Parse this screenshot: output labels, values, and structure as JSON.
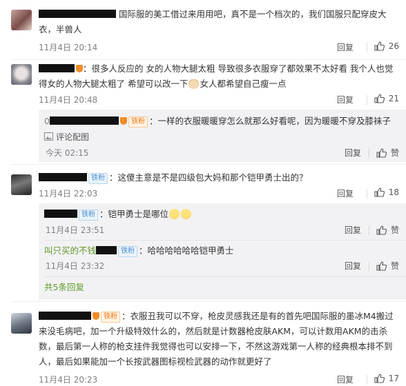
{
  "comments": [
    {
      "text": "国际服的美工借过来用用吧，真不是一个档次的，我们国服只配穿皮大衣，半兽人",
      "time": "11月4日 20:14",
      "reply": "回复",
      "likes": "26"
    },
    {
      "text_a": "：很多人反应的 女的人物大腿太粗 导致很多衣服穿了都效果不太好看 我个人也觉得女的人物大腿太粗了 希望可以改一下",
      "text_b": "女人都希望自己瘦一点",
      "time": "11月4日 20:48",
      "reply": "回复",
      "likes": "21",
      "replies": [
        {
          "badge": "铁粉",
          "text": "一样的衣服暖暖穿怎么就那么好看呢，因为暖暖不穿及膝袜子",
          "extra": "评论配图",
          "time": "今天 02:15",
          "reply": "回复",
          "like_label": "赞"
        }
      ]
    },
    {
      "badge": "铁粉",
      "text": "这傻主意是不是四级包大妈和那个铠甲勇士出的？",
      "time": "11月4日 22:03",
      "reply": "回复",
      "likes": "18",
      "replies": [
        {
          "badge": "铁粉",
          "text": "铠甲勇士是哪位",
          "time": "11月4日 23:51",
          "reply": "回复",
          "like_label": "赞"
        },
        {
          "name_visible": "叫只买的不钱",
          "badge": "铁粉",
          "text": "哈哈哈哈哈哈铠甲勇士",
          "time": "11月4日 23:32",
          "reply": "回复",
          "like_label": "赞"
        }
      ],
      "more_replies": "共5条回复"
    },
    {
      "badge": "铁粉",
      "text": "：衣服丑我可以不穿，枪皮灵感我还是有的首先吧国际服的墨冰M4搬过来没毛病吧，加一个升级特效什么的，然后就是计数器枪皮肤AKM，可以计数用AKM的击杀数，最后第一人称的枪支挂件我觉得也可以安排一下，不然这游戏第一人称的经典根本排不到人，最后如果能加一个长按武器图标视检武器的动作就更好了",
      "time": "11月4日 20:23",
      "reply": "回复",
      "likes": "17"
    }
  ],
  "icons": {
    "like": "thumb-up-icon",
    "badge_icon": "shield-icon",
    "image": "image-icon"
  },
  "colors": {
    "text": "#333333",
    "meta": "#808080",
    "green": "#629925",
    "badge_blue": "#4c8fd0",
    "badge_orange": "#f07c12",
    "reply_bg": "#f2f2f5"
  }
}
